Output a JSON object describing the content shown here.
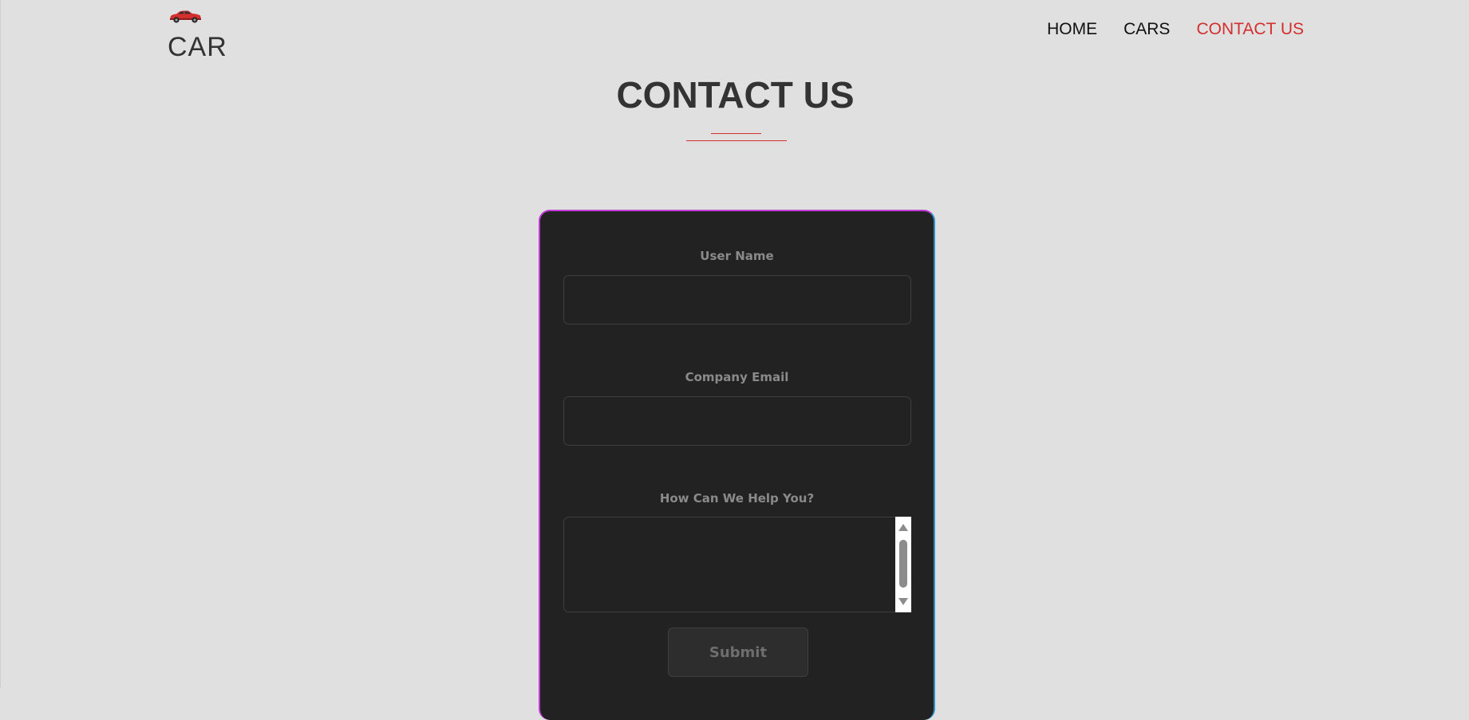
{
  "logo": {
    "icon": "red-car-icon",
    "text": "CAR"
  },
  "nav": {
    "items": [
      {
        "label": "HOME"
      },
      {
        "label": "CARS"
      },
      {
        "label": "CONTACT US",
        "active": true
      }
    ],
    "active_color": "#d32f2f"
  },
  "page": {
    "title": "CONTACT US"
  },
  "form": {
    "user_name_label": "User Name",
    "user_name_value": "",
    "email_label": "Company Email",
    "email_value": "",
    "message_label": "How Can We Help You?",
    "message_value": "",
    "submit_label": "Submit"
  },
  "colors": {
    "background": "#e0e0e0",
    "card": "#222222",
    "accent": "#d32f2f",
    "card_border_left": "#c23ad6",
    "card_border_right": "#2b8fc9"
  }
}
